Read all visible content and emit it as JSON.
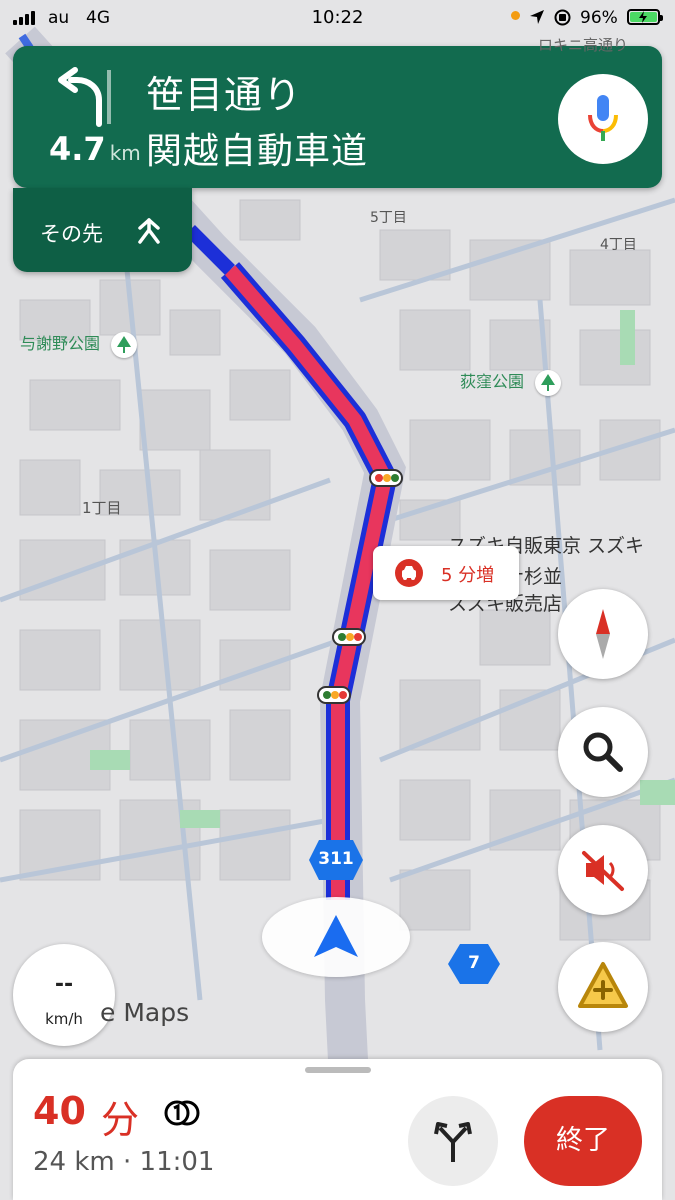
{
  "status_bar": {
    "carrier": "au",
    "network": "4G",
    "time": "10:22",
    "battery_percent": "96%",
    "battery_color": "#4cd964"
  },
  "navigation": {
    "distance_value": "4.7",
    "distance_unit": "km",
    "street_primary": "笹目通り",
    "street_secondary": "関越自動車道",
    "then_label": "その先",
    "banner_color": "#126b4f"
  },
  "map": {
    "labels": [
      "5丁目",
      "4丁目",
      "1丁目",
      "与謝野公園",
      "荻窪公園",
      "ロキニ高通り"
    ],
    "poi_lines": [
      "スズキ自販東京 スズキ",
      "アリーナ杉並",
      "スズキ販売店"
    ],
    "delay_text": "5 分増",
    "route_shields": [
      "311",
      "7"
    ],
    "speed_value": "--",
    "speed_unit": "km/h",
    "watermark": "e Maps",
    "route_color": "#e8365d"
  },
  "controls": {
    "mic": "mic-icon",
    "compass": "compass-icon",
    "search": "search-icon",
    "mute": "volume-off-icon",
    "report": "report-incident-icon"
  },
  "trip": {
    "eta_minutes": "40",
    "eta_unit": "分",
    "distance": "24 km",
    "separator": "·",
    "arrival_time": "11:01",
    "exit_label": "終了",
    "accent_color": "#d93025"
  }
}
